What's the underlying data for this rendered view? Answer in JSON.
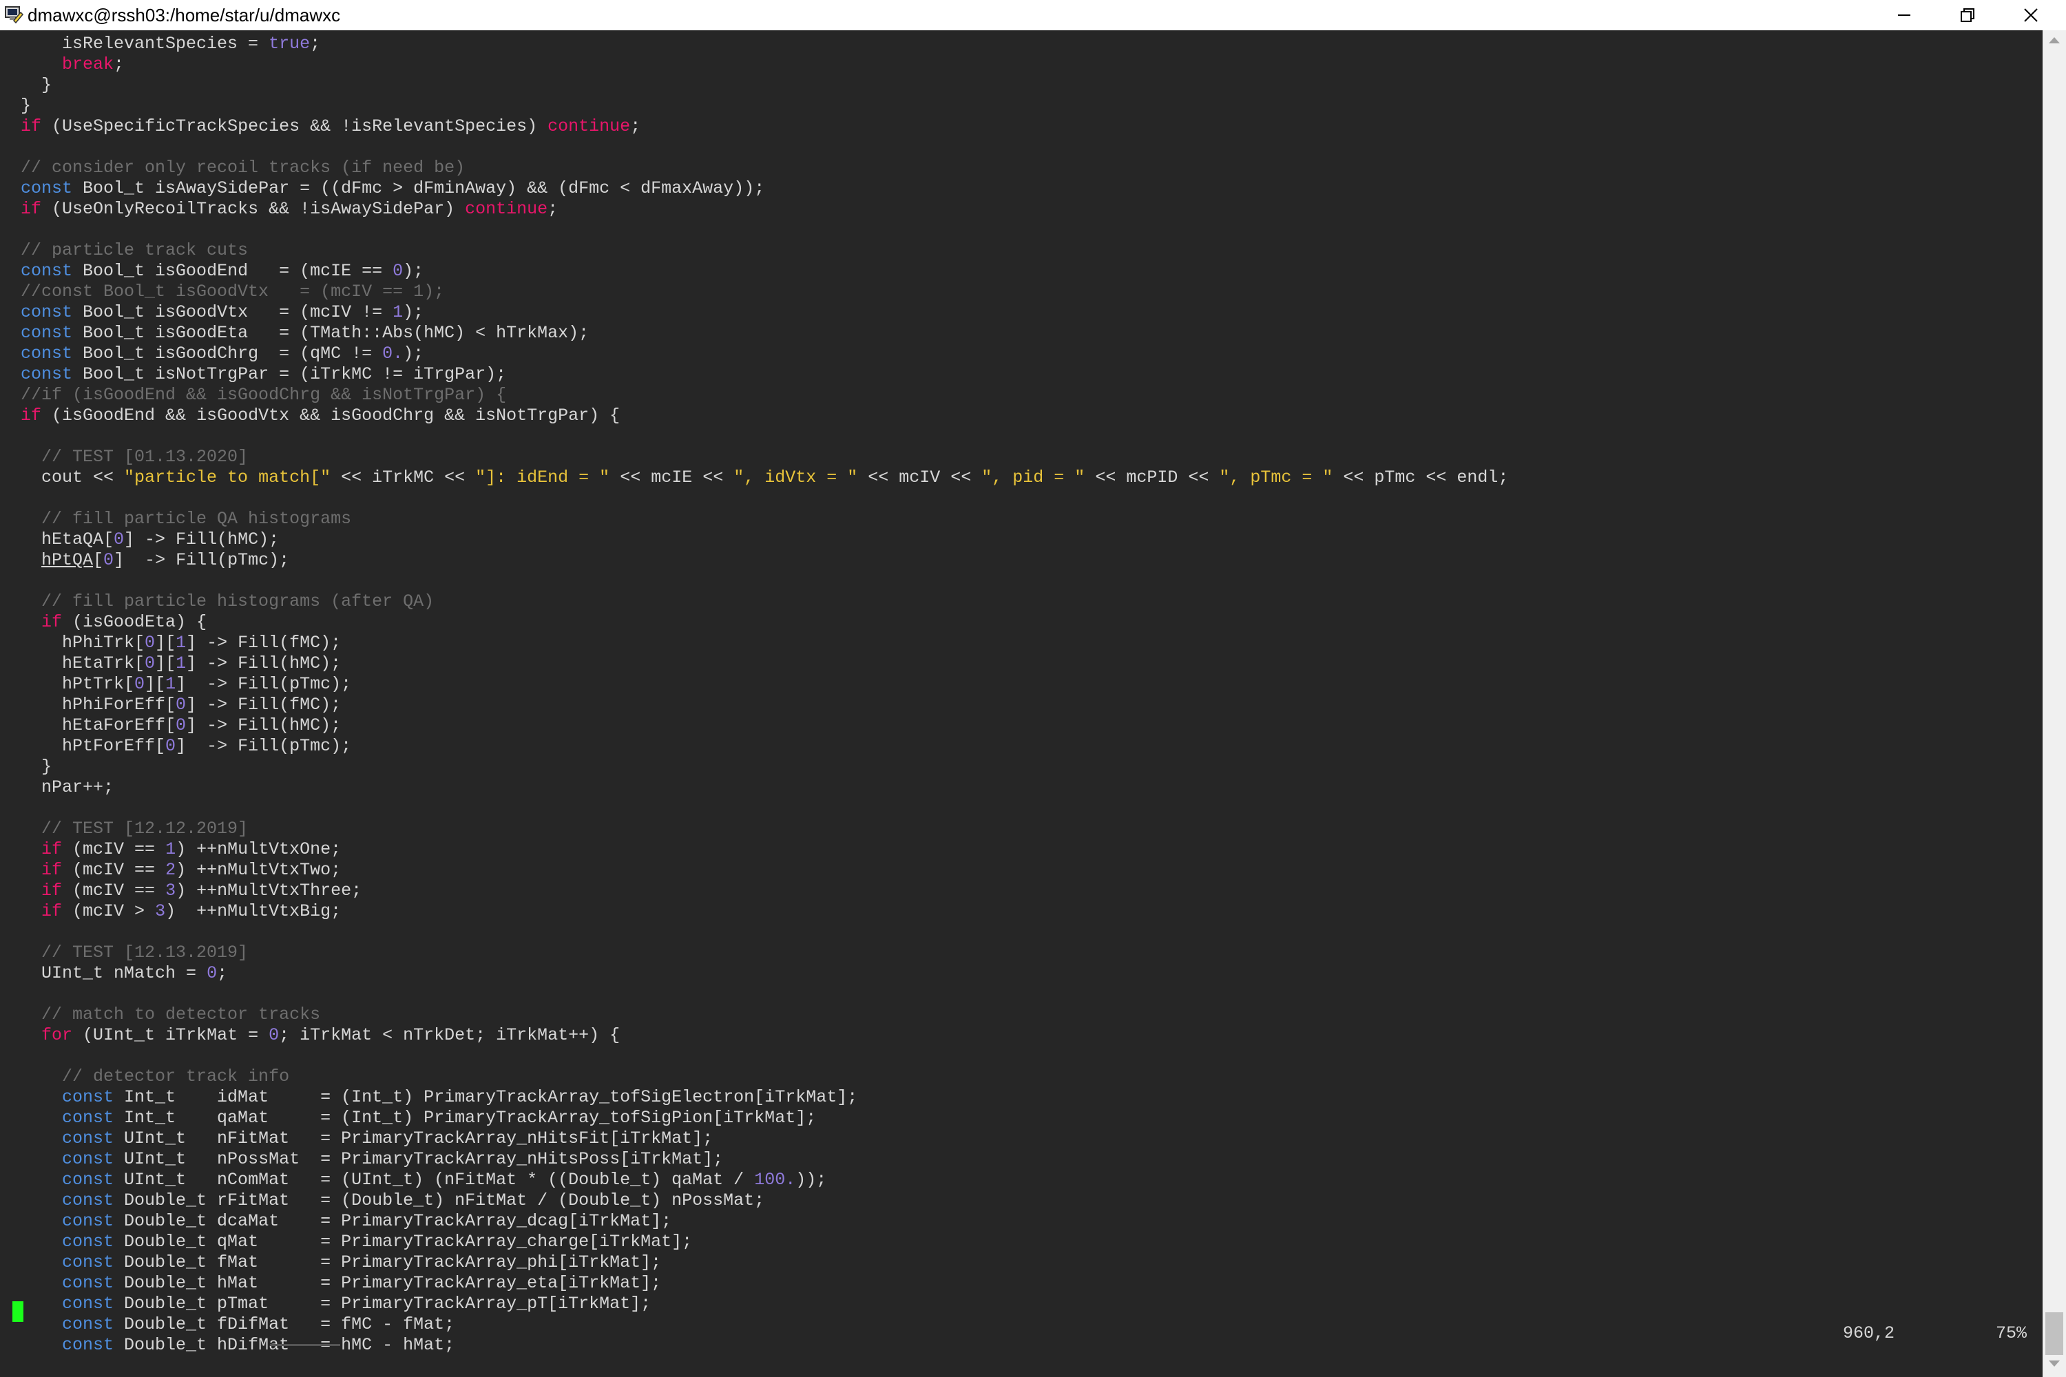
{
  "window": {
    "title": "dmawxc@rssh03:/home/star/u/dmawxc",
    "icon": "putty-terminal-icon",
    "controls": {
      "minimize": "─",
      "maximize": "❐",
      "close": "✕"
    }
  },
  "colors": {
    "background": "#262626",
    "text": "#d6d6d6",
    "keyword": "#4f8fe0",
    "control": "#e8166a",
    "number": "#8f7adb",
    "string": "#e8c33a",
    "comment": "#6e6e6e",
    "cursor": "#1aff1a"
  },
  "editor": {
    "lines": [
      [
        [
          "",
          "      isRelevantSpecies = "
        ],
        [
          "nm",
          "true"
        ],
        [
          "",
          ";"
        ]
      ],
      [
        [
          "",
          "      "
        ],
        [
          "ct",
          "break"
        ],
        [
          "",
          ";"
        ]
      ],
      [
        [
          "",
          "    }"
        ]
      ],
      [
        [
          "",
          "  }"
        ]
      ],
      [
        [
          "",
          "  "
        ],
        [
          "ct",
          "if"
        ],
        [
          "",
          " (UseSpecificTrackSpecies && !isRelevantSpecies) "
        ],
        [
          "ct",
          "continue"
        ],
        [
          "",
          ";"
        ]
      ],
      [],
      [
        [
          "cm",
          "  // consider only recoil tracks (if need be)"
        ]
      ],
      [
        [
          "",
          "  "
        ],
        [
          "kw",
          "const"
        ],
        [
          "",
          " Bool_t isAwaySidePar = ((dFmc > dFminAway) && (dFmc < dFmaxAway));"
        ]
      ],
      [
        [
          "",
          "  "
        ],
        [
          "ct",
          "if"
        ],
        [
          "",
          " (UseOnlyRecoilTracks && !isAwaySidePar) "
        ],
        [
          "ct",
          "continue"
        ],
        [
          "",
          ";"
        ]
      ],
      [],
      [
        [
          "cm",
          "  // particle track cuts"
        ]
      ],
      [
        [
          "",
          "  "
        ],
        [
          "kw",
          "const"
        ],
        [
          "",
          " Bool_t isGoodEnd   = (mcIE == "
        ],
        [
          "nm",
          "0"
        ],
        [
          "",
          ");"
        ]
      ],
      [
        [
          "cm",
          "  //const Bool_t isGoodVtx   = (mcIV == 1);"
        ]
      ],
      [
        [
          "",
          "  "
        ],
        [
          "kw",
          "const"
        ],
        [
          "",
          " Bool_t isGoodVtx   = (mcIV != "
        ],
        [
          "nm",
          "1"
        ],
        [
          "",
          ");"
        ]
      ],
      [
        [
          "",
          "  "
        ],
        [
          "kw",
          "const"
        ],
        [
          "",
          " Bool_t isGoodEta   = (TMath::Abs(hMC) < hTrkMax);"
        ]
      ],
      [
        [
          "",
          "  "
        ],
        [
          "kw",
          "const"
        ],
        [
          "",
          " Bool_t isGoodChrg  = (qMC != "
        ],
        [
          "nm",
          "0."
        ],
        [
          "",
          ");"
        ]
      ],
      [
        [
          "",
          "  "
        ],
        [
          "kw",
          "const"
        ],
        [
          "",
          " Bool_t isNotTrgPar = (iTrkMC != iTrgPar);"
        ]
      ],
      [
        [
          "cm",
          "  //if (isGoodEnd && isGoodChrg && isNotTrgPar) {"
        ]
      ],
      [
        [
          "",
          "  "
        ],
        [
          "ct",
          "if"
        ],
        [
          "",
          " (isGoodEnd && isGoodVtx && isGoodChrg && isNotTrgPar) {"
        ]
      ],
      [],
      [
        [
          "cm",
          "    // TEST [01.13.2020]"
        ]
      ],
      [
        [
          "",
          "    cout << "
        ],
        [
          "st",
          "\"particle to match[\""
        ],
        [
          "",
          " << iTrkMC << "
        ],
        [
          "st",
          "\"]: idEnd = \""
        ],
        [
          "",
          " << mcIE << "
        ],
        [
          "st",
          "\", idVtx = \""
        ],
        [
          "",
          " << mcIV << "
        ],
        [
          "st",
          "\", pid = \""
        ],
        [
          "",
          " << mcPID << "
        ],
        [
          "st",
          "\", pTmc = \""
        ],
        [
          "",
          " << pTmc << endl;"
        ]
      ],
      [],
      [
        [
          "cm",
          "    // fill particle QA histograms"
        ]
      ],
      [
        [
          "",
          "    hEtaQA["
        ],
        [
          "nm",
          "0"
        ],
        [
          "",
          "] -> Fill(hMC);"
        ]
      ],
      [
        [
          "",
          "    "
        ],
        [
          "ul",
          "hPtQA"
        ],
        [
          "",
          "["
        ],
        [
          "nm",
          "0"
        ],
        [
          "",
          "]  -> Fill(pTmc);"
        ]
      ],
      [],
      [
        [
          "cm",
          "    // fill particle histograms (after QA)"
        ]
      ],
      [
        [
          "",
          "    "
        ],
        [
          "ct",
          "if"
        ],
        [
          "",
          " (isGoodEta) {"
        ]
      ],
      [
        [
          "",
          "      hPhiTrk["
        ],
        [
          "nm",
          "0"
        ],
        [
          "",
          "]["
        ],
        [
          "nm",
          "1"
        ],
        [
          "",
          "] -> Fill(fMC);"
        ]
      ],
      [
        [
          "",
          "      hEtaTrk["
        ],
        [
          "nm",
          "0"
        ],
        [
          "",
          "]["
        ],
        [
          "nm",
          "1"
        ],
        [
          "",
          "] -> Fill(hMC);"
        ]
      ],
      [
        [
          "",
          "      hPtTrk["
        ],
        [
          "nm",
          "0"
        ],
        [
          "",
          "]["
        ],
        [
          "nm",
          "1"
        ],
        [
          "",
          "]  -> Fill(pTmc);"
        ]
      ],
      [
        [
          "",
          "      hPhiForEff["
        ],
        [
          "nm",
          "0"
        ],
        [
          "",
          "] -> Fill(fMC);"
        ]
      ],
      [
        [
          "",
          "      hEtaForEff["
        ],
        [
          "nm",
          "0"
        ],
        [
          "",
          "] -> Fill(hMC);"
        ]
      ],
      [
        [
          "",
          "      hPtForEff["
        ],
        [
          "nm",
          "0"
        ],
        [
          "",
          "]  -> Fill(pTmc);"
        ]
      ],
      [
        [
          "",
          "    }"
        ]
      ],
      [
        [
          "",
          "    nPar++;"
        ]
      ],
      [],
      [
        [
          "cm",
          "    // TEST [12.12.2019]"
        ]
      ],
      [
        [
          "",
          "    "
        ],
        [
          "ct",
          "if"
        ],
        [
          "",
          " (mcIV == "
        ],
        [
          "nm",
          "1"
        ],
        [
          "",
          ") ++nMultVtxOne;"
        ]
      ],
      [
        [
          "",
          "    "
        ],
        [
          "ct",
          "if"
        ],
        [
          "",
          " (mcIV == "
        ],
        [
          "nm",
          "2"
        ],
        [
          "",
          ") ++nMultVtxTwo;"
        ]
      ],
      [
        [
          "",
          "    "
        ],
        [
          "ct",
          "if"
        ],
        [
          "",
          " (mcIV == "
        ],
        [
          "nm",
          "3"
        ],
        [
          "",
          ") ++nMultVtxThree;"
        ]
      ],
      [
        [
          "",
          "    "
        ],
        [
          "ct",
          "if"
        ],
        [
          "",
          " (mcIV > "
        ],
        [
          "nm",
          "3"
        ],
        [
          "",
          ")  ++nMultVtxBig;"
        ]
      ],
      [],
      [
        [
          "cm",
          "    // TEST [12.13.2019]"
        ]
      ],
      [
        [
          "",
          "    UInt_t nMatch = "
        ],
        [
          "nm",
          "0"
        ],
        [
          "",
          ";"
        ]
      ],
      [],
      [
        [
          "cm",
          "    // match to detector tracks"
        ]
      ],
      [
        [
          "",
          "    "
        ],
        [
          "ct",
          "for"
        ],
        [
          "",
          " (UInt_t iTrkMat = "
        ],
        [
          "nm",
          "0"
        ],
        [
          "",
          "; iTrkMat < nTrkDet; iTrkMat++) {"
        ]
      ],
      [],
      [
        [
          "cm",
          "      // detector track info"
        ]
      ],
      [
        [
          "",
          "      "
        ],
        [
          "kw",
          "const"
        ],
        [
          "",
          " Int_t    idMat     = (Int_t) PrimaryTrackArray_tofSigElectron[iTrkMat];"
        ]
      ],
      [
        [
          "",
          "      "
        ],
        [
          "kw",
          "const"
        ],
        [
          "",
          " Int_t    qaMat     = (Int_t) PrimaryTrackArray_tofSigPion[iTrkMat];"
        ]
      ],
      [
        [
          "",
          "      "
        ],
        [
          "kw",
          "const"
        ],
        [
          "",
          " UInt_t   nFitMat   = PrimaryTrackArray_nHitsFit[iTrkMat];"
        ]
      ],
      [
        [
          "",
          "      "
        ],
        [
          "kw",
          "const"
        ],
        [
          "",
          " UInt_t   nPossMat  = PrimaryTrackArray_nHitsPoss[iTrkMat];"
        ]
      ],
      [
        [
          "",
          "      "
        ],
        [
          "kw",
          "const"
        ],
        [
          "",
          " UInt_t   nComMat   = (UInt_t) (nFitMat * ((Double_t) qaMat / "
        ],
        [
          "nm",
          "100."
        ],
        [
          "",
          "));"
        ]
      ],
      [
        [
          "",
          "      "
        ],
        [
          "kw",
          "const"
        ],
        [
          "",
          " Double_t rFitMat   = (Double_t) nFitMat / (Double_t) nPossMat;"
        ]
      ],
      [
        [
          "",
          "      "
        ],
        [
          "kw",
          "const"
        ],
        [
          "",
          " Double_t dcaMat    = PrimaryTrackArray_dcag[iTrkMat];"
        ]
      ],
      [
        [
          "",
          "      "
        ],
        [
          "kw",
          "const"
        ],
        [
          "",
          " Double_t qMat      = PrimaryTrackArray_charge[iTrkMat];"
        ]
      ],
      [
        [
          "",
          "      "
        ],
        [
          "kw",
          "const"
        ],
        [
          "",
          " Double_t fMat      = PrimaryTrackArray_phi[iTrkMat];"
        ]
      ],
      [
        [
          "",
          "      "
        ],
        [
          "kw",
          "const"
        ],
        [
          "",
          " Double_t hMat      = PrimaryTrackArray_eta[iTrkMat];"
        ]
      ],
      [
        [
          "",
          "      "
        ],
        [
          "kw",
          "const"
        ],
        [
          "",
          " Double_t pTmat     = PrimaryTrackArray_pT[iTrkMat];"
        ]
      ],
      [
        [
          "",
          "      "
        ],
        [
          "kw",
          "const"
        ],
        [
          "",
          " Double_t fDifMat   = fMC - fMat;"
        ]
      ],
      [
        [
          "",
          "      "
        ],
        [
          "kw",
          "const"
        ],
        [
          "",
          " Double_t hDifMat   = hMC - hMat;"
        ]
      ]
    ]
  },
  "status": {
    "position": "960,2",
    "percent": "75%"
  }
}
